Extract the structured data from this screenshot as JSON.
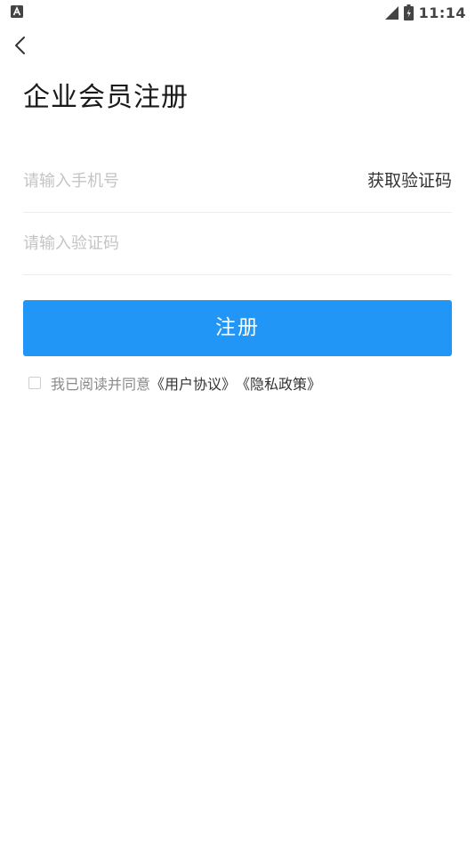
{
  "status_bar": {
    "left_icon": "notification-app-icon",
    "signal_icon": "signal-icon",
    "battery_icon": "battery-icon",
    "time": "11:14"
  },
  "header": {
    "back_icon": "chevron-left-icon",
    "title": "企业会员注册"
  },
  "form": {
    "phone_placeholder": "请输入手机号",
    "phone_value": "",
    "get_code_label": "获取验证码",
    "code_placeholder": "请输入验证码",
    "code_value": ""
  },
  "register_button": {
    "label": "注册",
    "color": "#2196f6"
  },
  "agreement": {
    "checked": false,
    "text": "我已阅读并同意",
    "user_agreement_link": "《用户协议》",
    "privacy_policy_link": "《隐私政策》"
  }
}
